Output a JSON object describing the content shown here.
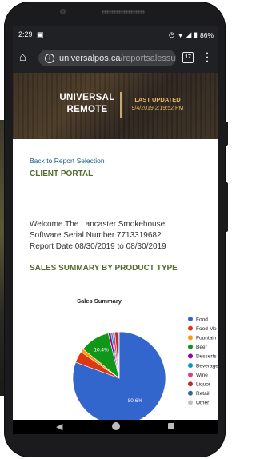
{
  "status_bar": {
    "time": "2:29",
    "notification_icon": "photo-icon",
    "icons": [
      "alarm-icon",
      "wifi-icon",
      "signal-icon",
      "battery-icon"
    ],
    "battery": "86%"
  },
  "browser": {
    "url_host": "universalpos.ca",
    "url_path": "/reportsalessum",
    "tab_count": "17",
    "home_icon": "home-icon",
    "menu_icon": "more-vert-icon"
  },
  "banner": {
    "brand_line1": "UNIVERSAL",
    "brand_line2": "REMOTE",
    "last_updated_label": "LAST UPDATED",
    "last_updated_value": "9/4/2019 2:19:52 PM"
  },
  "page": {
    "back_link": "Back to Report Selection",
    "portal_title": "CLIENT PORTAL",
    "welcome": "Welcome The Lancaster Smokehouse",
    "serial": "Software Serial Number 7713319682",
    "report_date": "Report Date 08/30/2019 to 08/30/2019",
    "sales_heading": "SALES SUMMARY BY PRODUCT TYPE"
  },
  "chart_data": {
    "type": "pie",
    "title": "Sales Summary",
    "legend_position": "right",
    "slices": [
      {
        "label": "Food",
        "value": 80.6,
        "color": "#3366cc",
        "data_label": "80.6%"
      },
      {
        "label": "Food Mo",
        "value": 4.0,
        "color": "#dc3912",
        "data_label": ""
      },
      {
        "label": "Fountain",
        "value": 1.2,
        "color": "#ff9900",
        "data_label": ""
      },
      {
        "label": "Beer",
        "value": 10.4,
        "color": "#109618",
        "data_label": "10.4%"
      },
      {
        "label": "Desserts",
        "value": 0.9,
        "color": "#990099",
        "data_label": ""
      },
      {
        "label": "Beverage",
        "value": 0.6,
        "color": "#0099c6",
        "data_label": ""
      },
      {
        "label": "Wine",
        "value": 0.8,
        "color": "#dd4477",
        "data_label": ""
      },
      {
        "label": "Liquor",
        "value": 1.0,
        "color": "#b82e2e",
        "data_label": ""
      },
      {
        "label": "Retail",
        "value": 0.4,
        "color": "#316395",
        "data_label": ""
      },
      {
        "label": "Other",
        "value": 0.1,
        "color": "#c0c0c0",
        "data_label": ""
      }
    ]
  },
  "nav": {
    "back_icon": "back-triangle-icon",
    "home_icon": "home-circle-icon",
    "recents_icon": "recents-square-icon"
  }
}
